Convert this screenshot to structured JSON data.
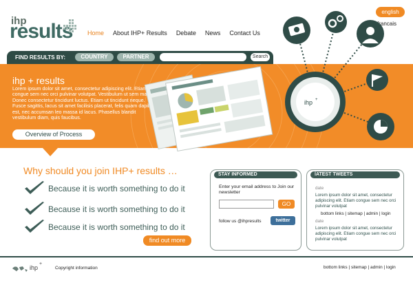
{
  "header": {
    "logo_ihp": "ihp",
    "logo_plus": "+",
    "logo_results": "results",
    "nav": [
      "Home",
      "About IHP+ Results",
      "Debate",
      "News",
      "Contact Us"
    ],
    "lang_active": "english",
    "lang_other": "francais"
  },
  "search": {
    "label": "FIND RESULTS BY:",
    "country": "COUNTRY",
    "partner": "PARTNER",
    "button": "Search"
  },
  "hero": {
    "title": "ihp + results",
    "body": "Lorem ipsum dolor sit amet, consectetur adipiscing elit. Etiam congue sem nec orci pulvinar volutpat. Vestibulum ut sem massa. Donec consectetur tincidunt luctus. Etiam ut tincidunt neque. Fusce sagittis, lacus sit amet facilisis placerat, felis quam dapibus est, nec accumsan leo massa id lacus. Phasellus blandit vestibulum diam, quis faucibus.",
    "button": "Overview of Process"
  },
  "why": {
    "title": "Why should you join IHP+ results …",
    "reasons": [
      "Because it is worth something to do it",
      "Because it is worth something to do it",
      "Because it is worth something to do it"
    ],
    "button": "find out more"
  },
  "stay": {
    "title": "STAY INFORMED",
    "text": "Enter your email address to Join our newsletter",
    "go": "GO",
    "follow": "follow us @ihpresults",
    "twitter": "twitter"
  },
  "tweets": {
    "title": "lATEST TWEETS",
    "items": [
      {
        "date": "date",
        "text": "Lorem ipsum dolor sit amet, consectetur adipiscing elit. Etiam congue sem nec orci pulvinar volutpat"
      },
      {
        "date": "date",
        "text": "Lorem ipsum dolor sit amet, consectetur adipiscing elit. Etiam congue sem nec orci pulvinar volutpat"
      }
    ],
    "overlap": "bottom links | sitemap | admin | login"
  },
  "footer": {
    "logo": "ihp",
    "logo_plus": "+",
    "copyright": "Copyright information",
    "links": "bottom links | sitemap | admin | login"
  },
  "icons": [
    "money-icon",
    "gears-icon",
    "doctor-icon",
    "flag-icon",
    "pie-chart-icon",
    "check-icon",
    "world-map-icon"
  ],
  "colors": {
    "orange": "#f28c28",
    "teal": "#2f4c47",
    "light_teal": "#9fb6af"
  }
}
